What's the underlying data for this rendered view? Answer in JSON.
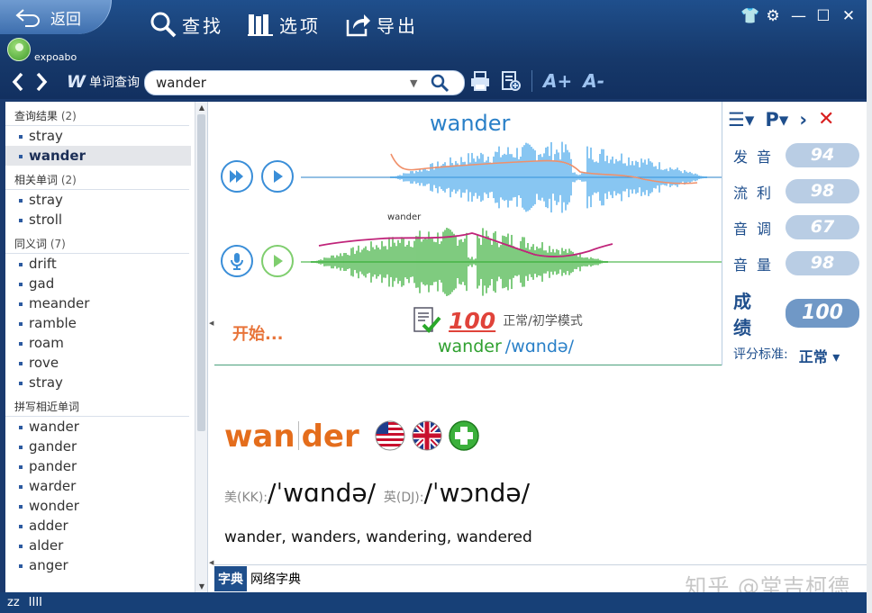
{
  "titlebar": {
    "back_label": "返回",
    "username": "expoabo",
    "tools": [
      {
        "label": "查找",
        "icon": "search-icon"
      },
      {
        "label": "选项",
        "icon": "books-icon"
      },
      {
        "label": "导出",
        "icon": "export-icon"
      }
    ]
  },
  "search": {
    "mode_label": "单词查询",
    "value": "wander"
  },
  "left_pane": {
    "groups": [
      {
        "title": "查询结果",
        "count": "(2)",
        "items": [
          "stray",
          "wander"
        ],
        "selected": 1
      },
      {
        "title": "相关单词",
        "count": "(2)",
        "items": [
          "stray",
          "stroll"
        ]
      },
      {
        "title": "同义词",
        "count": "(7)",
        "items": [
          "drift",
          "gad",
          "meander",
          "ramble",
          "roam",
          "rove",
          "stray"
        ]
      },
      {
        "title": "拼写相近单词",
        "count": "",
        "items": [
          "wander",
          "gander",
          "pander",
          "warder",
          "wonder",
          "adder",
          "alder",
          "anger"
        ]
      }
    ]
  },
  "pronunciation": {
    "word": "wander",
    "wave_label": "wander",
    "start_text": "开始...",
    "score": "100",
    "mode": "正常/初学模式",
    "word_phonetic": "wander",
    "ipa": "/wɑndə/",
    "colors": {
      "reference_wave": "#3aa0e8",
      "user_wave": "#2aa82a",
      "pitch_ref": "#f0906a",
      "pitch_user": "#c0247a"
    }
  },
  "score_panel": {
    "rows": [
      {
        "label": "发音",
        "value": "94"
      },
      {
        "label": "流利",
        "value": "98"
      },
      {
        "label": "音调",
        "value": "67"
      },
      {
        "label": "音量",
        "value": "98"
      }
    ],
    "total_label": "成绩",
    "total_value": "100",
    "criteria_label": "评分标准:",
    "criteria_value": "正常"
  },
  "dictionary": {
    "headword_part1": "wan",
    "headword_part2": "der",
    "us_label": "美(KK):",
    "us_ipa": "/ˈwɑndə/",
    "uk_label": "英(DJ):",
    "uk_ipa": "/ˈwɔndə/",
    "forms": "wander, wanders, wandering, wandered"
  },
  "tabs": [
    "字典",
    "网络字典"
  ],
  "watermark": "知乎 @堂吉柯德",
  "status": {
    "sleep": "zz",
    "signal": "IIII"
  }
}
